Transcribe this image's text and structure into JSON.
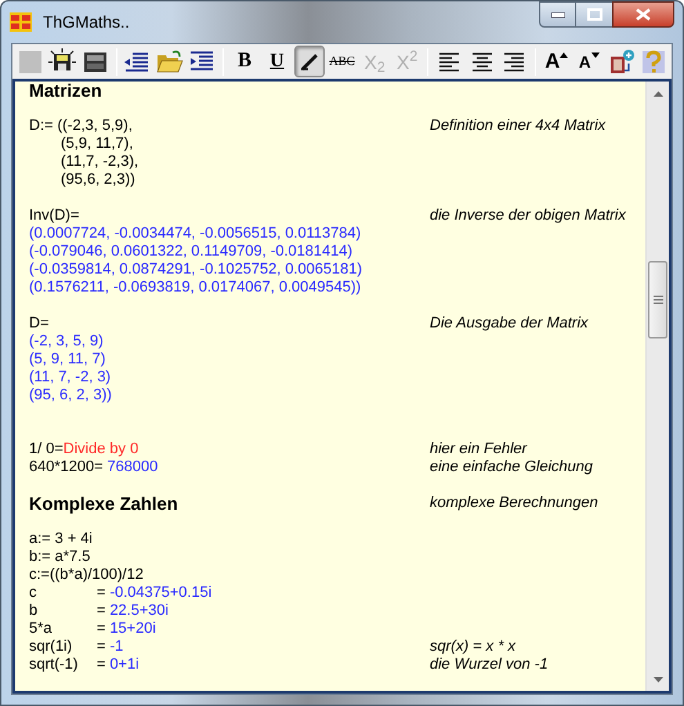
{
  "window": {
    "title": "ThGMaths.."
  },
  "toolbar": {
    "groups": [
      {
        "tools": [
          {
            "kind": "blank",
            "pressed": false,
            "disabled": true
          },
          {
            "kind": "save",
            "pressed": false,
            "disabled": false
          },
          {
            "kind": "device",
            "pressed": false,
            "disabled": false
          }
        ]
      },
      {
        "tools": [
          {
            "kind": "outdent",
            "pressed": false,
            "disabled": false
          },
          {
            "kind": "open",
            "pressed": false,
            "disabled": false
          },
          {
            "kind": "indent",
            "pressed": false,
            "disabled": false
          }
        ]
      },
      {
        "tools": [
          {
            "kind": "bold",
            "label": "B",
            "pressed": false,
            "disabled": false
          },
          {
            "kind": "underline",
            "label": "U",
            "pressed": false,
            "disabled": false
          },
          {
            "kind": "italic",
            "pressed": true,
            "disabled": false
          },
          {
            "kind": "strike",
            "label": "ABC",
            "pressed": false,
            "disabled": false
          },
          {
            "kind": "subscript",
            "label": "X$_{2}$",
            "pressed": false,
            "disabled": true
          },
          {
            "kind": "superscript",
            "label": "X$^{2}$",
            "pressed": false,
            "disabled": true
          }
        ]
      },
      {
        "tools": [
          {
            "kind": "align_left",
            "pressed": false,
            "disabled": false
          },
          {
            "kind": "align_center",
            "pressed": false,
            "disabled": false
          },
          {
            "kind": "align_right",
            "pressed": false,
            "disabled": false
          }
        ]
      },
      {
        "tools": [
          {
            "kind": "grow",
            "label": "A",
            "pressed": false,
            "disabled": false
          },
          {
            "kind": "shrink",
            "label": "A",
            "pressed": false,
            "disabled": false
          },
          {
            "kind": "insert",
            "pressed": false,
            "disabled": false
          },
          {
            "kind": "help",
            "pressed": false,
            "disabled": false
          }
        ]
      }
    ]
  },
  "document": {
    "rows": [
      {
        "kind": "heading",
        "text": "Matrizen"
      },
      {
        "kind": "blank"
      },
      {
        "kind": "line",
        "indented": false,
        "parts": [
          {
            "kind": "input",
            "text": "D:= ((-2,3, 5,9),"
          }
        ],
        "comment": "Definition einer 4x4 Matrix"
      },
      {
        "kind": "line",
        "indented": true,
        "parts": [
          {
            "kind": "input",
            "text": "(5,9, 11,7),"
          }
        ]
      },
      {
        "kind": "line",
        "indented": true,
        "parts": [
          {
            "kind": "input",
            "text": "(11,7, -2,3),"
          }
        ]
      },
      {
        "kind": "line",
        "indented": true,
        "parts": [
          {
            "kind": "input",
            "text": "(95,6, 2,3))"
          }
        ]
      },
      {
        "kind": "blank"
      },
      {
        "kind": "line",
        "indented": false,
        "parts": [
          {
            "kind": "input",
            "text": "Inv(D)="
          }
        ],
        "comment": "die Inverse der obigen Matrix"
      },
      {
        "kind": "line",
        "indented": false,
        "parts": [
          {
            "kind": "result",
            "text": "(0.0007724, -0.0034474, -0.0056515, 0.0113784)"
          }
        ]
      },
      {
        "kind": "line",
        "indented": false,
        "parts": [
          {
            "kind": "result",
            "text": "(-0.079046, 0.0601322, 0.1149709, -0.0181414)"
          }
        ]
      },
      {
        "kind": "line",
        "indented": false,
        "parts": [
          {
            "kind": "result",
            "text": "(-0.0359814, 0.0874291, -0.1025752, 0.0065181)"
          }
        ]
      },
      {
        "kind": "line",
        "indented": false,
        "parts": [
          {
            "kind": "result",
            "text": "(0.1576211, -0.0693819, 0.0174067, 0.0049545))"
          }
        ]
      },
      {
        "kind": "blank"
      },
      {
        "kind": "line",
        "indented": false,
        "parts": [
          {
            "kind": "input",
            "text": "D="
          }
        ],
        "comment": "Die Ausgabe der Matrix"
      },
      {
        "kind": "line",
        "indented": false,
        "parts": [
          {
            "kind": "result",
            "text": "(-2, 3, 5, 9)"
          }
        ]
      },
      {
        "kind": "line",
        "indented": false,
        "parts": [
          {
            "kind": "result",
            "text": "(5, 9, 11, 7)"
          }
        ]
      },
      {
        "kind": "line",
        "indented": false,
        "parts": [
          {
            "kind": "result",
            "text": "(11, 7, -2, 3)"
          }
        ]
      },
      {
        "kind": "line",
        "indented": false,
        "parts": [
          {
            "kind": "result",
            "text": "(95, 6, 2, 3))"
          }
        ]
      },
      {
        "kind": "blank"
      },
      {
        "kind": "blank"
      },
      {
        "kind": "line",
        "indented": false,
        "parts": [
          {
            "kind": "input",
            "text": "1/ 0="
          },
          {
            "kind": "error",
            "text": "Divide by 0"
          }
        ],
        "comment": "hier ein Fehler"
      },
      {
        "kind": "line",
        "indented": false,
        "parts": [
          {
            "kind": "input",
            "text": "640*1200="
          },
          {
            "kind": "result",
            "text": "768000"
          }
        ],
        "comment": "eine einfache Gleichung"
      },
      {
        "kind": "blank"
      },
      {
        "kind": "heading",
        "text": "Komplexe Zahlen",
        "comment": "komplexe Berechnungen"
      },
      {
        "kind": "blank"
      },
      {
        "kind": "line",
        "indented": false,
        "parts": [
          {
            "kind": "input",
            "text": "a:= 3 + 4i"
          }
        ]
      },
      {
        "kind": "line",
        "indented": false,
        "parts": [
          {
            "kind": "input",
            "text": "b:= a*7.5"
          }
        ]
      },
      {
        "kind": "line",
        "indented": false,
        "parts": [
          {
            "kind": "input",
            "text": "c:=((b*a)/100)/12"
          }
        ]
      },
      {
        "kind": "aligned",
        "name": "c",
        "parts": [
          {
            "kind": "input",
            "text": "="
          },
          {
            "kind": "result",
            "text": "-0.04375+0.15i"
          }
        ]
      },
      {
        "kind": "aligned",
        "name": "b",
        "parts": [
          {
            "kind": "input",
            "text": "="
          },
          {
            "kind": "result",
            "text": "22.5+30i"
          }
        ]
      },
      {
        "kind": "aligned",
        "name": "5*a",
        "parts": [
          {
            "kind": "input",
            "text": "="
          },
          {
            "kind": "result",
            "text": "15+20i"
          }
        ]
      },
      {
        "kind": "aligned",
        "name": "sqr(1i)",
        "parts": [
          {
            "kind": "input",
            "text": "="
          },
          {
            "kind": "result",
            "text": "-1"
          }
        ],
        "comment": "sqr(x) = x * x"
      },
      {
        "kind": "aligned",
        "name": "sqrt(-1)",
        "parts": [
          {
            "kind": "input",
            "text": "="
          },
          {
            "kind": "result",
            "text": "0+1i"
          }
        ],
        "comment": "die Wurzel von -1"
      }
    ]
  }
}
